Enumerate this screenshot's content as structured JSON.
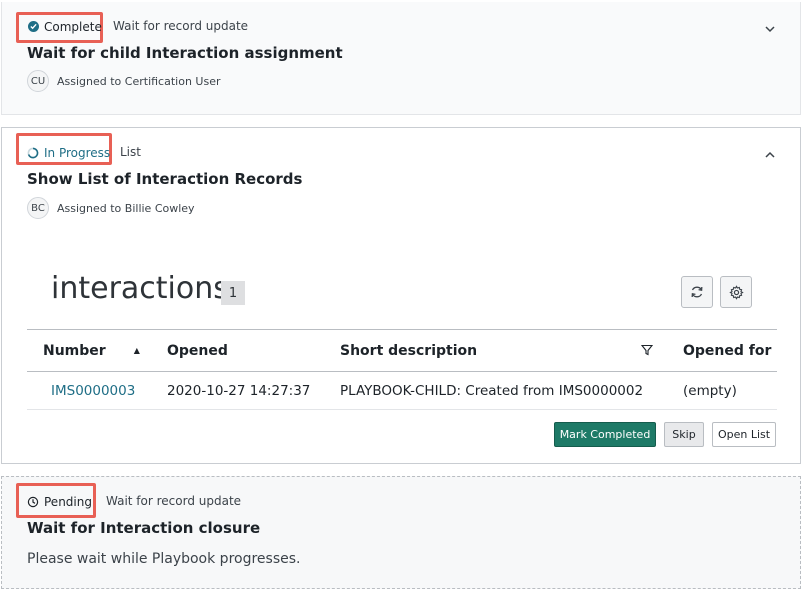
{
  "steps": [
    {
      "status": "Complete",
      "type": "Wait for record update",
      "title": "Wait for child Interaction assignment",
      "avatar": "CU",
      "assigned": "Assigned to Certification User"
    },
    {
      "status": "In Progress",
      "type": "List",
      "title": "Show List of Interaction Records",
      "avatar": "BC",
      "assigned": "Assigned to Billie Cowley",
      "list": {
        "title": "interactions",
        "count": "1",
        "columns": [
          "Number",
          "Opened",
          "Short description",
          "Opened for"
        ],
        "rows": [
          [
            "IMS0000003",
            "2020-10-27 14:27:37",
            "PLAYBOOK-CHILD: Created from IMS0000002",
            "(empty)"
          ]
        ]
      },
      "buttons": {
        "mark_completed": "Mark Completed",
        "skip": "Skip",
        "open_list": "Open List"
      }
    },
    {
      "status": "Pending",
      "type": "Wait for record update",
      "title": "Wait for Interaction closure",
      "description": "Please wait while Playbook progresses."
    }
  ],
  "colors": {
    "complete": "#1f6e86",
    "in_progress": "#1f6e86",
    "highlight": "#e86055",
    "primary_button": "#1e7a67"
  },
  "icons": {
    "complete": "check-circle-icon",
    "in_progress": "progress-ring-icon",
    "pending": "clock-icon",
    "refresh": "refresh-icon",
    "settings": "gear-icon",
    "filter": "filter-icon",
    "sort": "sort-ascending-icon"
  }
}
